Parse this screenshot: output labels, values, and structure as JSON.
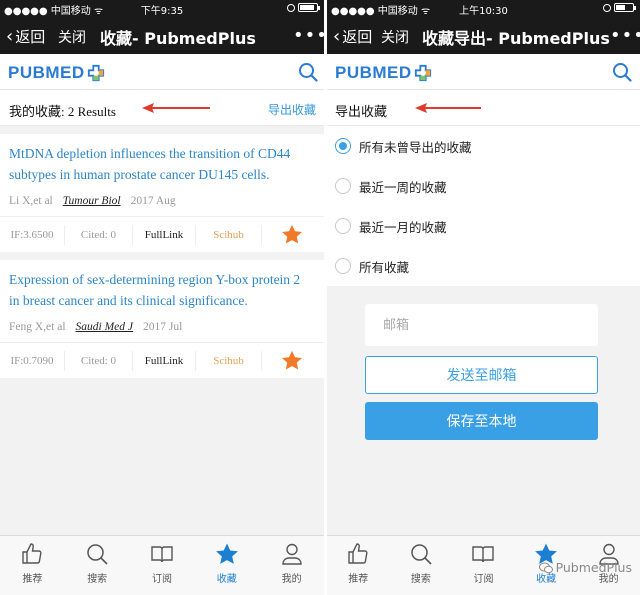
{
  "left": {
    "status": {
      "carrier": "●●●●● 中国移动 ᯤ",
      "time": "下午9:35"
    },
    "nav": {
      "back_label": "返回",
      "close_label": "关闭",
      "title": "收藏- PubmedPlus",
      "more": "•••"
    },
    "brand": {
      "logo_text": "PUBMED"
    },
    "list_header": {
      "title": "我的收藏: 2 Results",
      "export_label": "导出收藏"
    },
    "articles": [
      {
        "title": "MtDNA depletion influences the transition of CD44 subtypes in human prostate cancer DU145 cells.",
        "authors": "Li X,et al",
        "journal": "Tumour Biol",
        "date": "2017 Aug",
        "if": "IF:3.6500",
        "cited": "Cited: 0",
        "fulllink": "FullLink",
        "scihub": "Scihub"
      },
      {
        "title": "Expression of sex-determining region Y-box protein 2 in breast cancer and its clinical significance.",
        "authors": "Feng X,et al",
        "journal": "Saudi Med J",
        "date": "2017 Jul",
        "if": "IF:0.7090",
        "cited": "Cited: 0",
        "fulllink": "FullLink",
        "scihub": "Scihub"
      }
    ],
    "tabs": [
      {
        "label": "推荐",
        "icon": "thumbs-up-icon"
      },
      {
        "label": "搜索",
        "icon": "search-icon"
      },
      {
        "label": "订阅",
        "icon": "book-icon"
      },
      {
        "label": "收藏",
        "icon": "star-icon"
      },
      {
        "label": "我的",
        "icon": "user-icon"
      }
    ]
  },
  "right": {
    "status": {
      "carrier": "●●●●● 中国移动 ᯤ",
      "time": "上午10:30"
    },
    "nav": {
      "back_label": "返回",
      "close_label": "关闭",
      "title": "收藏导出- PubmedPlus",
      "more": "•••"
    },
    "brand": {
      "logo_text": "PUBMED"
    },
    "export_header": {
      "title": "导出收藏"
    },
    "options": [
      {
        "label": "所有未曾导出的收藏",
        "selected": true
      },
      {
        "label": "最近一周的收藏",
        "selected": false
      },
      {
        "label": "最近一月的收藏",
        "selected": false
      },
      {
        "label": "所有收藏",
        "selected": false
      }
    ],
    "email_placeholder": "邮箱",
    "send_label": "发送至邮箱",
    "save_label": "保存至本地",
    "tabs": [
      {
        "label": "推荐",
        "icon": "thumbs-up-icon"
      },
      {
        "label": "搜索",
        "icon": "search-icon"
      },
      {
        "label": "订阅",
        "icon": "book-icon"
      },
      {
        "label": "收藏",
        "icon": "star-icon"
      },
      {
        "label": "我的",
        "icon": "user-icon"
      }
    ],
    "watermark": "PubmedPlus"
  },
  "colors": {
    "accent": "#3aa0e6",
    "link": "#2c86c7",
    "star": "#f07a2a",
    "scihub": "#e3a25a",
    "arrow": "#e03a2e",
    "navbar": "#1a1a1a"
  }
}
